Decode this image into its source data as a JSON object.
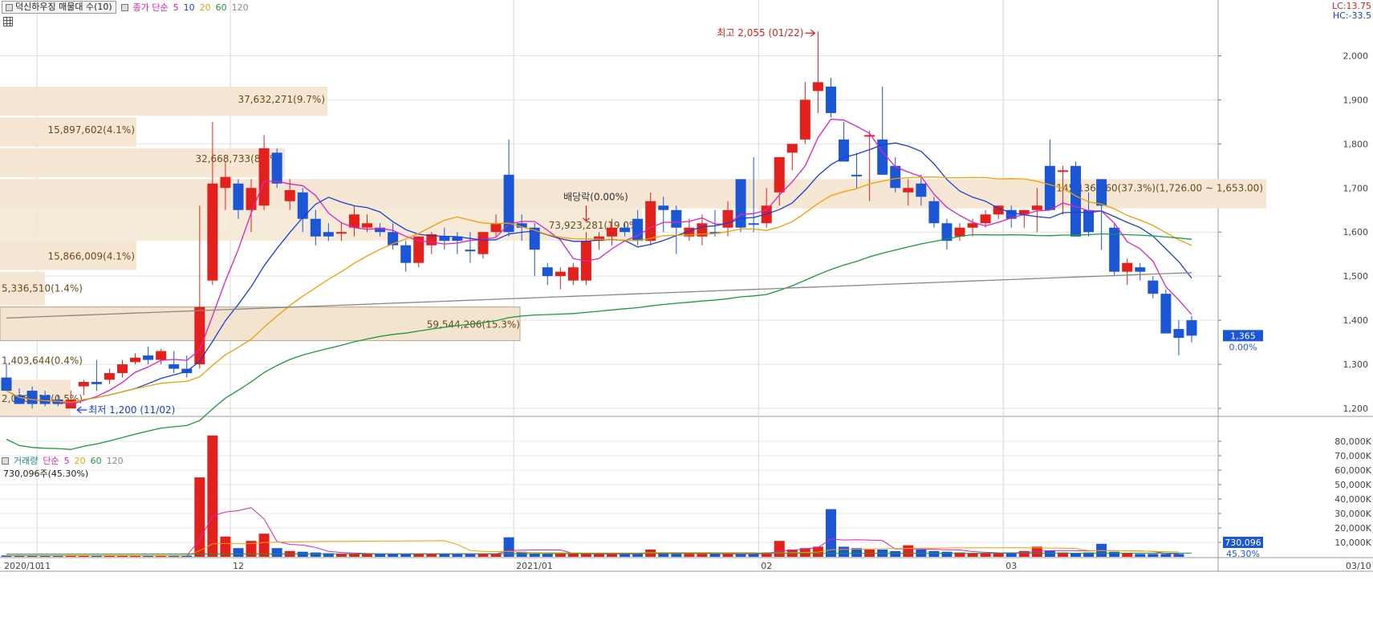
{
  "legend": {
    "stock_title": "덕신하우징 매물대 수(10)",
    "ma_prefix": "종가 단순",
    "ma_periods": [
      "5",
      "10",
      "20",
      "60",
      "120"
    ],
    "ma_colors": [
      "#e020c0",
      "#1a3fd6",
      "#f0a000",
      "#1a9a3a",
      "#888888"
    ],
    "lc": "LC:13.75",
    "hc": "HC:-33.5"
  },
  "volume_legend": {
    "title": "거래량",
    "ma_prefix": "단순",
    "ma_periods": [
      "5",
      "20",
      "60",
      "120"
    ],
    "ma_colors": [
      "#e020c0",
      "#f0a000",
      "#1a9a3a",
      "#888888"
    ],
    "current": "730,096주(45.30%)"
  },
  "annotations": {
    "high": "최고 2,055 (01/22)",
    "low": "최저 1,200 (11/02)",
    "dividend": "배당락(0.00%)",
    "last_price": "1,365",
    "last_change": "0.00%",
    "last_volume": "730,096",
    "last_volume_pct": "45.30%"
  },
  "chart_data": [
    {
      "type": "candlestick",
      "title": "덕신하우징 매물대 수(10)",
      "ylim": [
        1180,
        2090
      ],
      "y_ticks": [
        1200,
        1300,
        1400,
        1500,
        1600,
        1700,
        1800,
        1900,
        2000
      ],
      "y_tick_labels": [
        "1,200",
        "1,300",
        "1,400",
        "1,500",
        "1,600",
        "1,700",
        "1,800",
        "1,900",
        "2,000"
      ],
      "x_labels": [
        "2020/10",
        "11",
        "12",
        "2021/01",
        "02",
        "03",
        "03/10"
      ],
      "candles": [
        [
          1270,
          1300,
          1250,
          1240,
          -1
        ],
        [
          1230,
          1245,
          1210,
          1210,
          -1
        ],
        [
          1240,
          1250,
          1200,
          1210,
          -1
        ],
        [
          1230,
          1240,
          1205,
          1210,
          -1
        ],
        [
          1220,
          1230,
          1205,
          1210,
          -1
        ],
        [
          1220,
          1240,
          1200,
          1200,
          1
        ],
        [
          1250,
          1265,
          1230,
          1260,
          1
        ],
        [
          1260,
          1310,
          1240,
          1255,
          -1
        ],
        [
          1265,
          1290,
          1255,
          1280,
          1
        ],
        [
          1280,
          1310,
          1270,
          1300,
          1
        ],
        [
          1305,
          1325,
          1300,
          1315,
          1
        ],
        [
          1310,
          1340,
          1300,
          1320,
          -1
        ],
        [
          1310,
          1335,
          1300,
          1330,
          1
        ],
        [
          1300,
          1330,
          1280,
          1290,
          -1
        ],
        [
          1280,
          1320,
          1270,
          1290,
          -1
        ],
        [
          1300,
          1660,
          1290,
          1430,
          1
        ],
        [
          1490,
          1850,
          1480,
          1710,
          1
        ],
        [
          1700,
          1760,
          1650,
          1725,
          1
        ],
        [
          1710,
          1720,
          1630,
          1650,
          -1
        ],
        [
          1650,
          1720,
          1600,
          1700,
          1
        ],
        [
          1660,
          1820,
          1650,
          1790,
          1
        ],
        [
          1780,
          1790,
          1700,
          1710,
          -1
        ],
        [
          1670,
          1720,
          1650,
          1695,
          1
        ],
        [
          1690,
          1700,
          1600,
          1630,
          -1
        ],
        [
          1630,
          1650,
          1570,
          1590,
          -1
        ],
        [
          1600,
          1620,
          1580,
          1590,
          -1
        ],
        [
          1600,
          1620,
          1580,
          1600,
          1
        ],
        [
          1610,
          1660,
          1590,
          1640,
          1
        ],
        [
          1620,
          1640,
          1600,
          1610,
          1
        ],
        [
          1610,
          1620,
          1590,
          1600,
          -1
        ],
        [
          1600,
          1620,
          1560,
          1570,
          -1
        ],
        [
          1570,
          1580,
          1510,
          1530,
          -1
        ],
        [
          1530,
          1590,
          1520,
          1590,
          1
        ],
        [
          1570,
          1600,
          1550,
          1595,
          1
        ],
        [
          1590,
          1610,
          1560,
          1580,
          -1
        ],
        [
          1590,
          1600,
          1550,
          1580,
          -1
        ],
        [
          1560,
          1600,
          1530,
          1560,
          -1
        ],
        [
          1550,
          1600,
          1540,
          1600,
          1
        ],
        [
          1600,
          1640,
          1590,
          1620,
          1
        ],
        [
          1600,
          1810,
          1590,
          1730,
          -1
        ],
        [
          1620,
          1640,
          1580,
          1610,
          -1
        ],
        [
          1610,
          1620,
          1500,
          1560,
          -1
        ],
        [
          1520,
          1530,
          1480,
          1500,
          -1
        ],
        [
          1500,
          1520,
          1470,
          1510,
          1
        ],
        [
          1490,
          1530,
          1480,
          1520,
          1
        ],
        [
          1490,
          1600,
          1480,
          1580,
          1
        ],
        [
          1580,
          1600,
          1560,
          1590,
          1
        ],
        [
          1590,
          1630,
          1570,
          1610,
          1
        ],
        [
          1610,
          1620,
          1590,
          1600,
          -1
        ],
        [
          1630,
          1650,
          1570,
          1580,
          -1
        ],
        [
          1580,
          1690,
          1570,
          1670,
          1
        ],
        [
          1660,
          1680,
          1600,
          1650,
          -1
        ],
        [
          1650,
          1660,
          1550,
          1610,
          -1
        ],
        [
          1590,
          1630,
          1580,
          1610,
          1
        ],
        [
          1590,
          1640,
          1570,
          1620,
          1
        ],
        [
          1600,
          1650,
          1590,
          1600,
          -1
        ],
        [
          1610,
          1670,
          1590,
          1650,
          1
        ],
        [
          1610,
          1710,
          1600,
          1720,
          -1
        ],
        [
          1620,
          1770,
          1600,
          1620,
          -1
        ],
        [
          1620,
          1700,
          1610,
          1660,
          1
        ],
        [
          1690,
          1720,
          1660,
          1770,
          1
        ],
        [
          1780,
          1780,
          1740,
          1800,
          1
        ],
        [
          1810,
          1940,
          1800,
          1900,
          1
        ],
        [
          1920,
          2055,
          1870,
          1940,
          1
        ],
        [
          1930,
          1950,
          1860,
          1870,
          -1
        ],
        [
          1810,
          1850,
          1770,
          1760,
          -1
        ],
        [
          1730,
          1780,
          1700,
          1730,
          -1
        ],
        [
          1820,
          1830,
          1670,
          1820,
          1
        ],
        [
          1810,
          1930,
          1730,
          1730,
          -1
        ],
        [
          1750,
          1770,
          1690,
          1700,
          -1
        ],
        [
          1690,
          1720,
          1660,
          1700,
          1
        ],
        [
          1710,
          1730,
          1660,
          1680,
          -1
        ],
        [
          1670,
          1680,
          1610,
          1620,
          -1
        ],
        [
          1620,
          1630,
          1560,
          1580,
          -1
        ],
        [
          1590,
          1620,
          1580,
          1610,
          1
        ],
        [
          1610,
          1630,
          1590,
          1620,
          1
        ],
        [
          1620,
          1650,
          1610,
          1640,
          1
        ],
        [
          1640,
          1660,
          1630,
          1660,
          1
        ],
        [
          1650,
          1660,
          1610,
          1630,
          -1
        ],
        [
          1640,
          1650,
          1610,
          1650,
          1
        ],
        [
          1650,
          1700,
          1600,
          1660,
          1
        ],
        [
          1750,
          1810,
          1660,
          1650,
          -1
        ],
        [
          1740,
          1750,
          1640,
          1740,
          1
        ],
        [
          1750,
          1760,
          1590,
          1590,
          -1
        ],
        [
          1650,
          1690,
          1590,
          1600,
          -1
        ],
        [
          1720,
          1720,
          1560,
          1660,
          -1
        ],
        [
          1610,
          1620,
          1500,
          1510,
          -1
        ],
        [
          1510,
          1540,
          1480,
          1530,
          1
        ],
        [
          1520,
          1530,
          1490,
          1510,
          -1
        ],
        [
          1490,
          1500,
          1450,
          1460,
          -1
        ],
        [
          1460,
          1470,
          1370,
          1370,
          -1
        ],
        [
          1380,
          1400,
          1320,
          1360,
          -1
        ],
        [
          1400,
          1410,
          1350,
          1365,
          -1
        ]
      ],
      "volume_profile": [
        {
          "price_low": 1180,
          "price_high": 1265,
          "label": "2,086,216(0.5%)"
        },
        {
          "price_low": 1265,
          "price_high": 1350,
          "label": "1,403,644(0.4%)"
        },
        {
          "price_low": 1350,
          "price_high": 1430,
          "label": "59,544,206(15.3%)"
        },
        {
          "price_low": 1430,
          "price_high": 1510,
          "label": "5,336,510(1.4%)"
        },
        {
          "price_low": 1510,
          "price_high": 1580,
          "label": "15,866,009(4.1%)"
        },
        {
          "price_low": 1580,
          "price_high": 1720,
          "label": "73,923,281(19.0%)"
        },
        {
          "price_low": 1650,
          "price_high": 1720,
          "label": "145,136,360(37.3%)(1,726.00 ~ 1,653.00)"
        },
        {
          "price_low": 1720,
          "price_high": 1790,
          "label": "32,668,733(8.4%)"
        },
        {
          "price_low": 1790,
          "price_high": 1860,
          "label": "15,897,602(4.1%)"
        },
        {
          "price_low": 1860,
          "price_high": 1930,
          "label": "37,632,271(9.7%)"
        }
      ]
    },
    {
      "type": "bar",
      "title": "거래량",
      "ylim": [
        0,
        90000
      ],
      "y_ticks": [
        10000,
        20000,
        30000,
        40000,
        50000,
        60000,
        70000,
        80000
      ],
      "y_tick_labels": [
        "10,000K",
        "20,000K",
        "30,000K",
        "40,000K",
        "50,000K",
        "60,000K",
        "70,000K",
        "80,000K"
      ],
      "values": [
        900,
        900,
        900,
        900,
        900,
        900,
        900,
        900,
        900,
        900,
        900,
        900,
        900,
        900,
        900,
        55000,
        84000,
        14000,
        6000,
        11000,
        16000,
        6000,
        4000,
        3500,
        3000,
        2500,
        2000,
        2000,
        2000,
        2000,
        2000,
        2000,
        2000,
        2000,
        2000,
        2000,
        2000,
        2000,
        2000,
        13500,
        3500,
        2500,
        2000,
        2000,
        2000,
        2000,
        2000,
        2000,
        2000,
        2000,
        5000,
        3000,
        2000,
        2000,
        2000,
        2000,
        2000,
        2000,
        2000,
        3000,
        11000,
        5000,
        6000,
        7000,
        33000,
        7000,
        6000,
        5000,
        5000,
        4000,
        8000,
        5000,
        4000,
        3500,
        3000,
        2500,
        2500,
        2500,
        3000,
        4000,
        7000,
        4500,
        3000,
        2500,
        3000,
        9000,
        3500,
        2500,
        2000,
        2000,
        2000,
        2000
      ],
      "up": [
        0,
        0,
        0,
        0,
        0,
        1,
        1,
        0,
        1,
        1,
        1,
        0,
        1,
        0,
        0,
        1,
        1,
        1,
        0,
        1,
        1,
        0,
        1,
        0,
        0,
        0,
        1,
        1,
        1,
        0,
        0,
        0,
        1,
        1,
        0,
        0,
        0,
        1,
        1,
        0,
        0,
        0,
        0,
        1,
        1,
        1,
        1,
        1,
        0,
        0,
        1,
        0,
        0,
        1,
        1,
        0,
        1,
        0,
        0,
        1,
        1,
        1,
        1,
        1,
        0,
        0,
        0,
        1,
        0,
        0,
        1,
        0,
        0,
        0,
        1,
        1,
        1,
        1,
        0,
        1,
        1,
        0,
        1,
        0,
        0,
        0,
        0,
        1,
        0,
        0,
        0,
        0
      ],
      "current": "730,096주(45.30%)"
    }
  ]
}
